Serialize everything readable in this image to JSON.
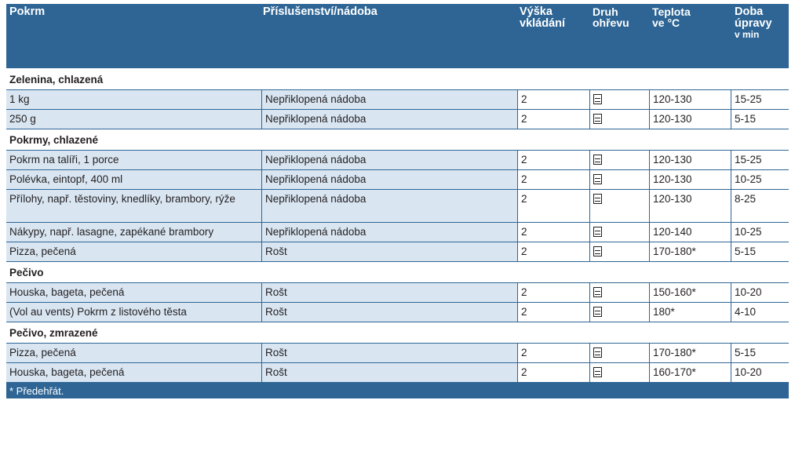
{
  "header": {
    "pokrm": "Pokrm",
    "prislusenstvi": "Příslušenství/nádoba",
    "vyska_1": "Výška",
    "vyska_2": "vkládání",
    "druh_1": "Druh",
    "druh_2": "ohřevu",
    "teplota_1": "Teplota",
    "teplota_2": "ve °C",
    "doba_1": "Doba",
    "doba_2": "úpravy",
    "doba_3": "v min"
  },
  "icons": {
    "heating_mode": "oven-steam-icon"
  },
  "groups": [
    {
      "title": "Zelenina, chlazená",
      "rows": [
        {
          "food": "1 kg",
          "accessory": "Nepřiklopená nádoba",
          "level": "2",
          "temp": "120-130",
          "time": "15-25"
        },
        {
          "food": "250 g",
          "accessory": "Nepřiklopená nádoba",
          "level": "2",
          "temp": "120-130",
          "time": "5-15"
        }
      ]
    },
    {
      "title": "Pokrmy, chlazené",
      "rows": [
        {
          "food": "Pokrm na talíři, 1 porce",
          "accessory": "Nepřiklopená nádoba",
          "level": "2",
          "temp": "120-130",
          "time": "15-25"
        },
        {
          "food": "Polévka, eintopf, 400 ml",
          "accessory": "Nepřiklopená nádoba",
          "level": "2",
          "temp": "120-130",
          "time": "10-25"
        },
        {
          "food": "Přílohy, např. těstoviny, knedlíky, brambory, rýže",
          "accessory": "Nepřiklopená nádoba",
          "level": "2",
          "temp": "120-130",
          "time": "8-25"
        },
        {
          "food": "Nákypy, např. lasagne, zapékané brambory",
          "accessory": "Nepřiklopená nádoba",
          "level": "2",
          "temp": "120-140",
          "time": "10-25"
        },
        {
          "food": "Pizza, pečená",
          "accessory": "Rošt",
          "level": "2",
          "temp": "170-180*",
          "time": "5-15"
        }
      ]
    },
    {
      "title": "Pečivo",
      "rows": [
        {
          "food": "Houska, bageta, pečená",
          "accessory": "Rošt",
          "level": "2",
          "temp": "150-160*",
          "time": "10-20"
        },
        {
          "food": "(Vol au vents) Pokrm z listového těsta",
          "accessory": "Rošt",
          "level": "2",
          "temp": "180*",
          "time": "4-10"
        }
      ]
    },
    {
      "title": "Pečivo, zmrazené",
      "rows": [
        {
          "food": "Pizza, pečená",
          "accessory": "Rošt",
          "level": "2",
          "temp": "170-180*",
          "time": "5-15"
        },
        {
          "food": "Houska, bageta, pečená",
          "accessory": "Rošt",
          "level": "2",
          "temp": "160-170*",
          "time": "10-20"
        }
      ]
    }
  ],
  "footnote": "* Předehřát."
}
